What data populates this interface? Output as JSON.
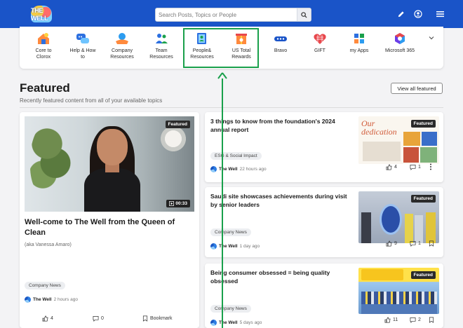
{
  "header": {
    "logo_text": "THE WELL",
    "search_placeholder": "Search Posts, Topics or People",
    "colors": {
      "bar": "#1a54c8",
      "accent": "#19a04b"
    }
  },
  "apps": [
    {
      "name": "core-to-clorox",
      "label1": "Core to",
      "label2": "Clorox"
    },
    {
      "name": "help-how-to",
      "label1": "Help & How",
      "label2": "to"
    },
    {
      "name": "company-resources",
      "label1": "Company",
      "label2": "Resources"
    },
    {
      "name": "team-resources",
      "label1": "Team",
      "label2": "Resources"
    },
    {
      "name": "people-resources",
      "label1": "People&",
      "label2": "Resources"
    },
    {
      "name": "us-total-rewards",
      "label1": "US Total",
      "label2": "Rewards"
    },
    {
      "name": "bravo",
      "label1": "Bravo",
      "label2": ""
    },
    {
      "name": "gift",
      "label1": "GIFT",
      "label2": ""
    },
    {
      "name": "my-apps",
      "label1": "my Apps",
      "label2": ""
    },
    {
      "name": "microsoft-365",
      "label1": "Microsoft 365",
      "label2": ""
    }
  ],
  "featured": {
    "heading": "Featured",
    "subtitle": "Recently featured content from all of your available topics",
    "view_all": "View all featured"
  },
  "main_post": {
    "badge": "Featured",
    "duration": "00:33",
    "title": "Well-come to The Well from the Queen of Clean",
    "subtitle": "(aka Vanessa Amaro)",
    "tag": "Company News",
    "author": "The Well",
    "time": "2 hours ago",
    "likes": "4",
    "comments": "0",
    "bookmark": "Bookmark"
  },
  "side_posts": [
    {
      "title": "3 things to know from the foundation's 2024 annual report",
      "tag": "ESG & Social Impact",
      "author": "The Well",
      "time": "22 hours ago",
      "likes": "4",
      "comments": "1",
      "badge": "Featured",
      "thumb_text": "Our dedication"
    },
    {
      "title": "Saudi site showcases achievements during visit by senior leaders",
      "tag": "Company News",
      "author": "The Well",
      "time": "1 day ago",
      "likes": "9",
      "comments": "1",
      "badge": "Featured"
    },
    {
      "title": "Being consumer obsessed = being quality obsessed",
      "tag": "Company News",
      "author": "The Well",
      "time": "5 days ago",
      "likes": "11",
      "comments": "2",
      "badge": "Featured"
    }
  ]
}
